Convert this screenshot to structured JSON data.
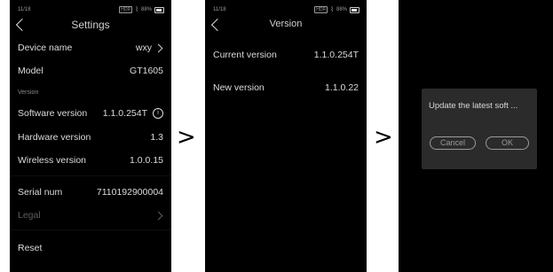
{
  "arrows": [
    ">",
    ">"
  ],
  "settings": {
    "status": {
      "date": "11/18",
      "badge": "HDR",
      "wifi_glyph": "⌇",
      "battery": "88%"
    },
    "title": "Settings",
    "device_name": {
      "label": "Device name",
      "value": "wxy"
    },
    "model": {
      "label": "Model",
      "value": "GT1605"
    },
    "section": "Version",
    "software": {
      "label": "Software version",
      "value": "1.1.0.254T",
      "info": "i"
    },
    "hardware": {
      "label": "Hardware version",
      "value": "1.3"
    },
    "wireless": {
      "label": "Wireless version",
      "value": "1.0.0.15"
    },
    "serial": {
      "label": "Serial num",
      "value": "7110192900004"
    },
    "legal": {
      "label": "Legal"
    },
    "reset": {
      "label": "Reset"
    }
  },
  "version": {
    "status": {
      "date": "11/18",
      "badge": "HDR",
      "wifi_glyph": "⌇",
      "battery": "88%"
    },
    "title": "Version",
    "current": {
      "label": "Current version",
      "value": "1.1.0.254T"
    },
    "new": {
      "label": "New version",
      "value": "1.1.0.22"
    }
  },
  "dialog": {
    "message": "Update the latest soft ...",
    "cancel": "Cancel",
    "ok": "OK"
  }
}
